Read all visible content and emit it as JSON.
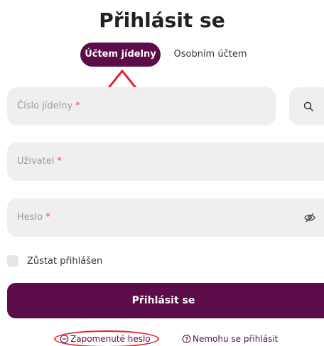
{
  "page": {
    "title": "Přihlásit se"
  },
  "tabs": [
    {
      "label": "Účtem jídelny",
      "active": true
    },
    {
      "label": "Osobním účtem",
      "active": false
    }
  ],
  "fields": {
    "canteen_number": {
      "placeholder": "Číslo jídelny",
      "required_mark": "*"
    },
    "user": {
      "placeholder": "Uživatel",
      "required_mark": "*"
    },
    "password": {
      "placeholder": "Heslo",
      "required_mark": "*"
    }
  },
  "remember": {
    "label": "Zůstat přihlášen",
    "checked": false
  },
  "submit": {
    "label": "Přihlásit se"
  },
  "links": {
    "forgot": "Zapomenuté heslo",
    "cant_login": "Nemohu se přihlásit"
  },
  "icons": {
    "search": "search-icon",
    "password_visibility": "eye-off-icon",
    "forgot": "unlink-icon",
    "help": "help-circle-icon"
  },
  "colors": {
    "accent": "#5d0c4a",
    "field_bg": "#f0efef",
    "required": "#e74a4a",
    "annotation": "#e0222a"
  }
}
